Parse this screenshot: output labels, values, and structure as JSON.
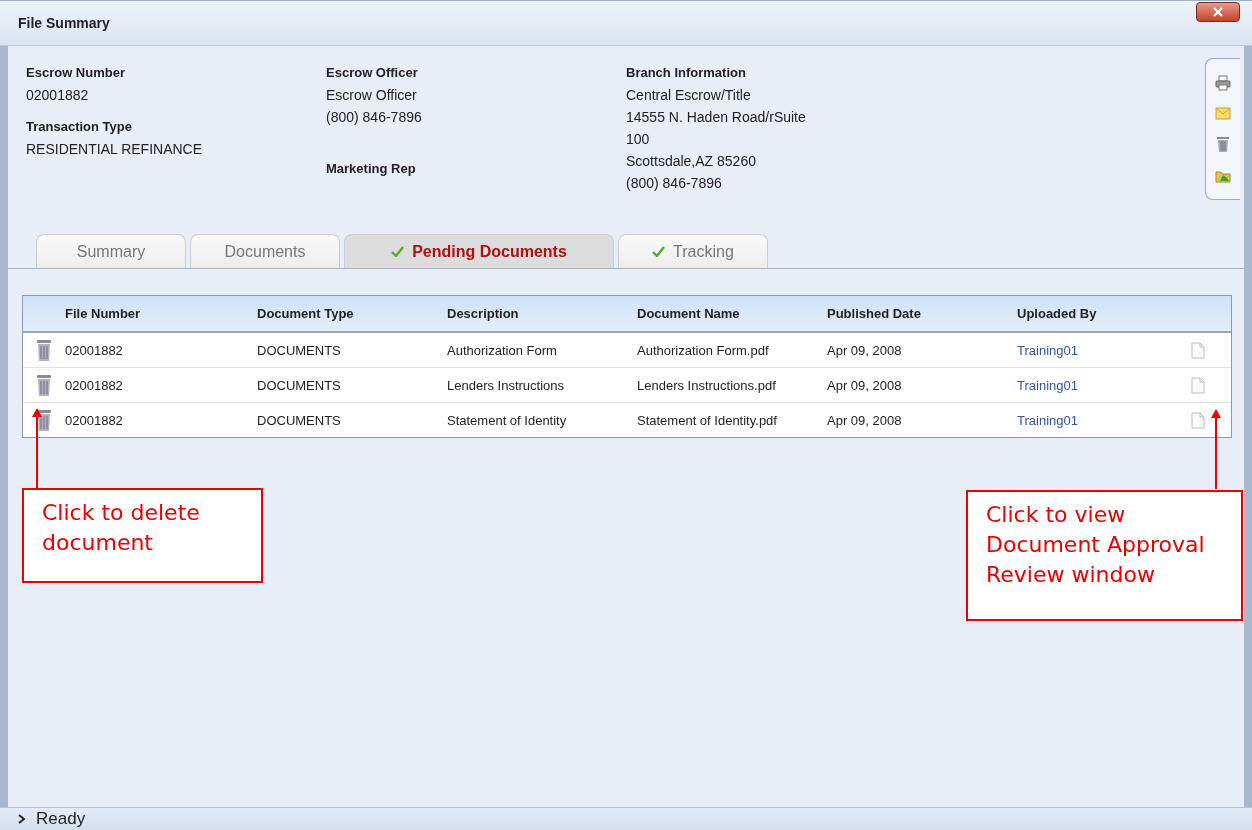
{
  "window": {
    "title": "File Summary"
  },
  "header": {
    "columns": [
      {
        "fields": [
          {
            "label": "Escrow Number",
            "lines": [
              "02001882"
            ]
          },
          {
            "label": "Transaction Type",
            "lines": [
              "RESIDENTIAL REFINANCE"
            ]
          }
        ]
      },
      {
        "fields": [
          {
            "label": "Escrow Officer",
            "lines": [
              "Escrow Officer",
              "(800) 846-7896"
            ]
          },
          {
            "label": "Marketing Rep"
          }
        ]
      },
      {
        "fields": [
          {
            "label": "Branch Information",
            "lines": [
              "Central Escrow/Title",
              "14555 N. Haden Road/rSuite",
              "100",
              "Scottsdale,AZ 85260",
              "(800) 846-7896"
            ]
          }
        ]
      }
    ]
  },
  "tabs": [
    {
      "label": "Summary",
      "selected": false,
      "checked": false
    },
    {
      "label": "Documents",
      "selected": false,
      "checked": false
    },
    {
      "label": "Pending Documents",
      "selected": true,
      "checked": true
    },
    {
      "label": "Tracking",
      "selected": false,
      "checked": true
    }
  ],
  "table": {
    "columns": [
      "File Number",
      "Document Type",
      "Description",
      "Document Name",
      "Published Date",
      "Uploaded By"
    ],
    "rows": [
      {
        "file_number": "02001882",
        "document_type": "DOCUMENTS",
        "description": "Authorization Form",
        "document_name": "Authorization Form.pdf",
        "published_date": "Apr 09, 2008",
        "uploaded_by": "Training01"
      },
      {
        "file_number": "02001882",
        "document_type": "DOCUMENTS",
        "description": "Lenders Instructions",
        "document_name": "Lenders Instructions.pdf",
        "published_date": "Apr 09, 2008",
        "uploaded_by": "Training01"
      },
      {
        "file_number": "02001882",
        "document_type": "DOCUMENTS",
        "description": "Statement of Identity",
        "document_name": "Statement of Identity.pdf",
        "published_date": "Apr 09, 2008",
        "uploaded_by": "Training01"
      }
    ]
  },
  "callouts": [
    {
      "text": "Click to delete document"
    },
    {
      "text": "Click to view Document Approval Review window"
    }
  ],
  "status_bar": {
    "text": "Ready"
  }
}
